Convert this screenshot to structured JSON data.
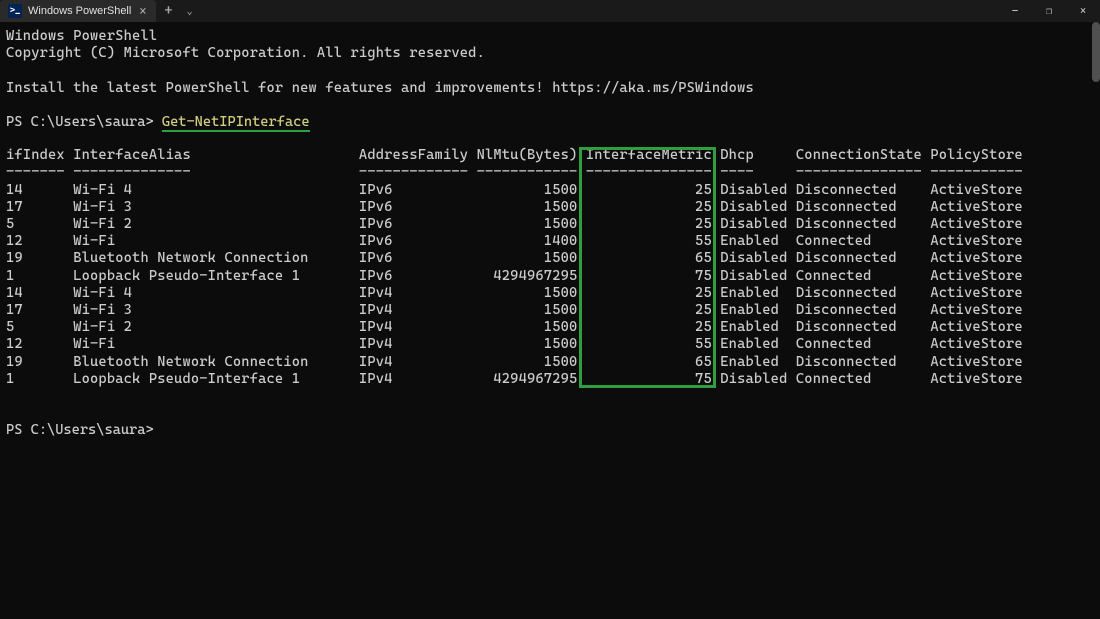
{
  "titlebar": {
    "tab_title": "Windows PowerShell",
    "ps_icon": ">_",
    "close": "×",
    "add": "+",
    "dropdown": "⌄",
    "minimize": "—",
    "maximize": "❐",
    "close_win": "×"
  },
  "header": {
    "line1": "Windows PowerShell",
    "line2": "Copyright (C) Microsoft Corporation. All rights reserved.",
    "install": "Install the latest PowerShell for new features and improvements! https://aka.ms/PSWindows"
  },
  "prompt": {
    "ps_prefix": "PS C:\\Users\\saura> ",
    "command": "Get-NetIPInterface"
  },
  "table": {
    "headers": {
      "ifIndex": "ifIndex",
      "InterfaceAlias": "InterfaceAlias",
      "AddressFamily": "AddressFamily",
      "NlMtu": "NlMtu(Bytes)",
      "InterfaceMetric": "InterfaceMetric",
      "Dhcp": "Dhcp",
      "ConnectionState": "ConnectionState",
      "PolicyStore": "PolicyStore"
    },
    "divider": {
      "ifIndex": "-------",
      "InterfaceAlias": "--------------",
      "AddressFamily": "-------------",
      "NlMtu": "------------",
      "InterfaceMetric": "---------------",
      "Dhcp": "----",
      "ConnectionState": "---------------",
      "PolicyStore": "-----------"
    },
    "rows": [
      {
        "ifIndex": "14",
        "InterfaceAlias": "Wi-Fi 4",
        "AddressFamily": "IPv6",
        "NlMtu": "1500",
        "InterfaceMetric": "25",
        "Dhcp": "Disabled",
        "ConnectionState": "Disconnected",
        "PolicyStore": "ActiveStore"
      },
      {
        "ifIndex": "17",
        "InterfaceAlias": "Wi-Fi 3",
        "AddressFamily": "IPv6",
        "NlMtu": "1500",
        "InterfaceMetric": "25",
        "Dhcp": "Disabled",
        "ConnectionState": "Disconnected",
        "PolicyStore": "ActiveStore"
      },
      {
        "ifIndex": "5",
        "InterfaceAlias": "Wi-Fi 2",
        "AddressFamily": "IPv6",
        "NlMtu": "1500",
        "InterfaceMetric": "25",
        "Dhcp": "Disabled",
        "ConnectionState": "Disconnected",
        "PolicyStore": "ActiveStore"
      },
      {
        "ifIndex": "12",
        "InterfaceAlias": "Wi-Fi",
        "AddressFamily": "IPv6",
        "NlMtu": "1400",
        "InterfaceMetric": "55",
        "Dhcp": "Enabled",
        "ConnectionState": "Connected",
        "PolicyStore": "ActiveStore"
      },
      {
        "ifIndex": "19",
        "InterfaceAlias": "Bluetooth Network Connection",
        "AddressFamily": "IPv6",
        "NlMtu": "1500",
        "InterfaceMetric": "65",
        "Dhcp": "Disabled",
        "ConnectionState": "Disconnected",
        "PolicyStore": "ActiveStore"
      },
      {
        "ifIndex": "1",
        "InterfaceAlias": "Loopback Pseudo-Interface 1",
        "AddressFamily": "IPv6",
        "NlMtu": "4294967295",
        "InterfaceMetric": "75",
        "Dhcp": "Disabled",
        "ConnectionState": "Connected",
        "PolicyStore": "ActiveStore"
      },
      {
        "ifIndex": "14",
        "InterfaceAlias": "Wi-Fi 4",
        "AddressFamily": "IPv4",
        "NlMtu": "1500",
        "InterfaceMetric": "25",
        "Dhcp": "Enabled",
        "ConnectionState": "Disconnected",
        "PolicyStore": "ActiveStore"
      },
      {
        "ifIndex": "17",
        "InterfaceAlias": "Wi-Fi 3",
        "AddressFamily": "IPv4",
        "NlMtu": "1500",
        "InterfaceMetric": "25",
        "Dhcp": "Enabled",
        "ConnectionState": "Disconnected",
        "PolicyStore": "ActiveStore"
      },
      {
        "ifIndex": "5",
        "InterfaceAlias": "Wi-Fi 2",
        "AddressFamily": "IPv4",
        "NlMtu": "1500",
        "InterfaceMetric": "25",
        "Dhcp": "Enabled",
        "ConnectionState": "Disconnected",
        "PolicyStore": "ActiveStore"
      },
      {
        "ifIndex": "12",
        "InterfaceAlias": "Wi-Fi",
        "AddressFamily": "IPv4",
        "NlMtu": "1500",
        "InterfaceMetric": "55",
        "Dhcp": "Enabled",
        "ConnectionState": "Connected",
        "PolicyStore": "ActiveStore"
      },
      {
        "ifIndex": "19",
        "InterfaceAlias": "Bluetooth Network Connection",
        "AddressFamily": "IPv4",
        "NlMtu": "1500",
        "InterfaceMetric": "65",
        "Dhcp": "Enabled",
        "ConnectionState": "Disconnected",
        "PolicyStore": "ActiveStore"
      },
      {
        "ifIndex": "1",
        "InterfaceAlias": "Loopback Pseudo-Interface 1",
        "AddressFamily": "IPv4",
        "NlMtu": "4294967295",
        "InterfaceMetric": "75",
        "Dhcp": "Disabled",
        "ConnectionState": "Connected",
        "PolicyStore": "ActiveStore"
      }
    ]
  },
  "prompt_end": "PS C:\\Users\\saura>"
}
